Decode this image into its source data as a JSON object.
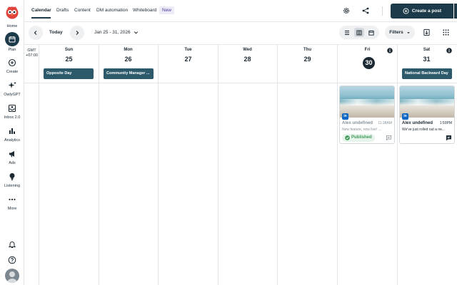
{
  "sidebar": {
    "items": [
      {
        "label": "Home",
        "icon": "owl-home-icon"
      },
      {
        "label": "Plan",
        "icon": "calendar-icon"
      },
      {
        "label": "Create",
        "icon": "plus-circle-icon"
      },
      {
        "label": "OwlyGPT",
        "icon": "sparkle-icon"
      },
      {
        "label": "Inbox 2.0",
        "icon": "inbox-icon"
      },
      {
        "label": "Analytics",
        "icon": "bar-chart-icon"
      },
      {
        "label": "Ads",
        "icon": "megaphone-icon"
      },
      {
        "label": "Listening",
        "icon": "lightbulb-icon"
      },
      {
        "label": "More",
        "icon": "ellipsis-icon"
      }
    ]
  },
  "topbar": {
    "tabs": [
      {
        "label": "Calendar"
      },
      {
        "label": "Drafts"
      },
      {
        "label": "Content"
      },
      {
        "label": "DM automation"
      },
      {
        "label": "Whiteboard"
      }
    ],
    "new_badge": "New",
    "create_label": "Create a post"
  },
  "toolbar": {
    "today_label": "Today",
    "date_range": "Jan 25 - 31, 2026",
    "filters_label": "Filters"
  },
  "calendar": {
    "timezone_line1": "GMT",
    "timezone_line2": "+07:00",
    "days": [
      {
        "dow": "Sun",
        "num": "25"
      },
      {
        "dow": "Mon",
        "num": "26"
      },
      {
        "dow": "Tue",
        "num": "27"
      },
      {
        "dow": "Wed",
        "num": "28"
      },
      {
        "dow": "Thu",
        "num": "29"
      },
      {
        "dow": "Fri",
        "num": "30"
      },
      {
        "dow": "Sat",
        "num": "31"
      }
    ],
    "holidays": {
      "sun": "Opposite Day",
      "mon": "Community Manager ...",
      "sat": "National Backward Day"
    },
    "posts": [
      {
        "author": "Alex undefined",
        "time": "11:38AM",
        "text": "New feature, now live! ...",
        "status": "Published",
        "network": "in"
      },
      {
        "author": "Alex undefined",
        "time": "1:50PM",
        "text": "We've just rolled out a ne...",
        "network": "in"
      }
    ]
  },
  "colors": {
    "primary": "#1d3a4a",
    "holiday": "#2d5a6b",
    "published": "#3f9a58",
    "linkedin": "#0a66c2"
  }
}
